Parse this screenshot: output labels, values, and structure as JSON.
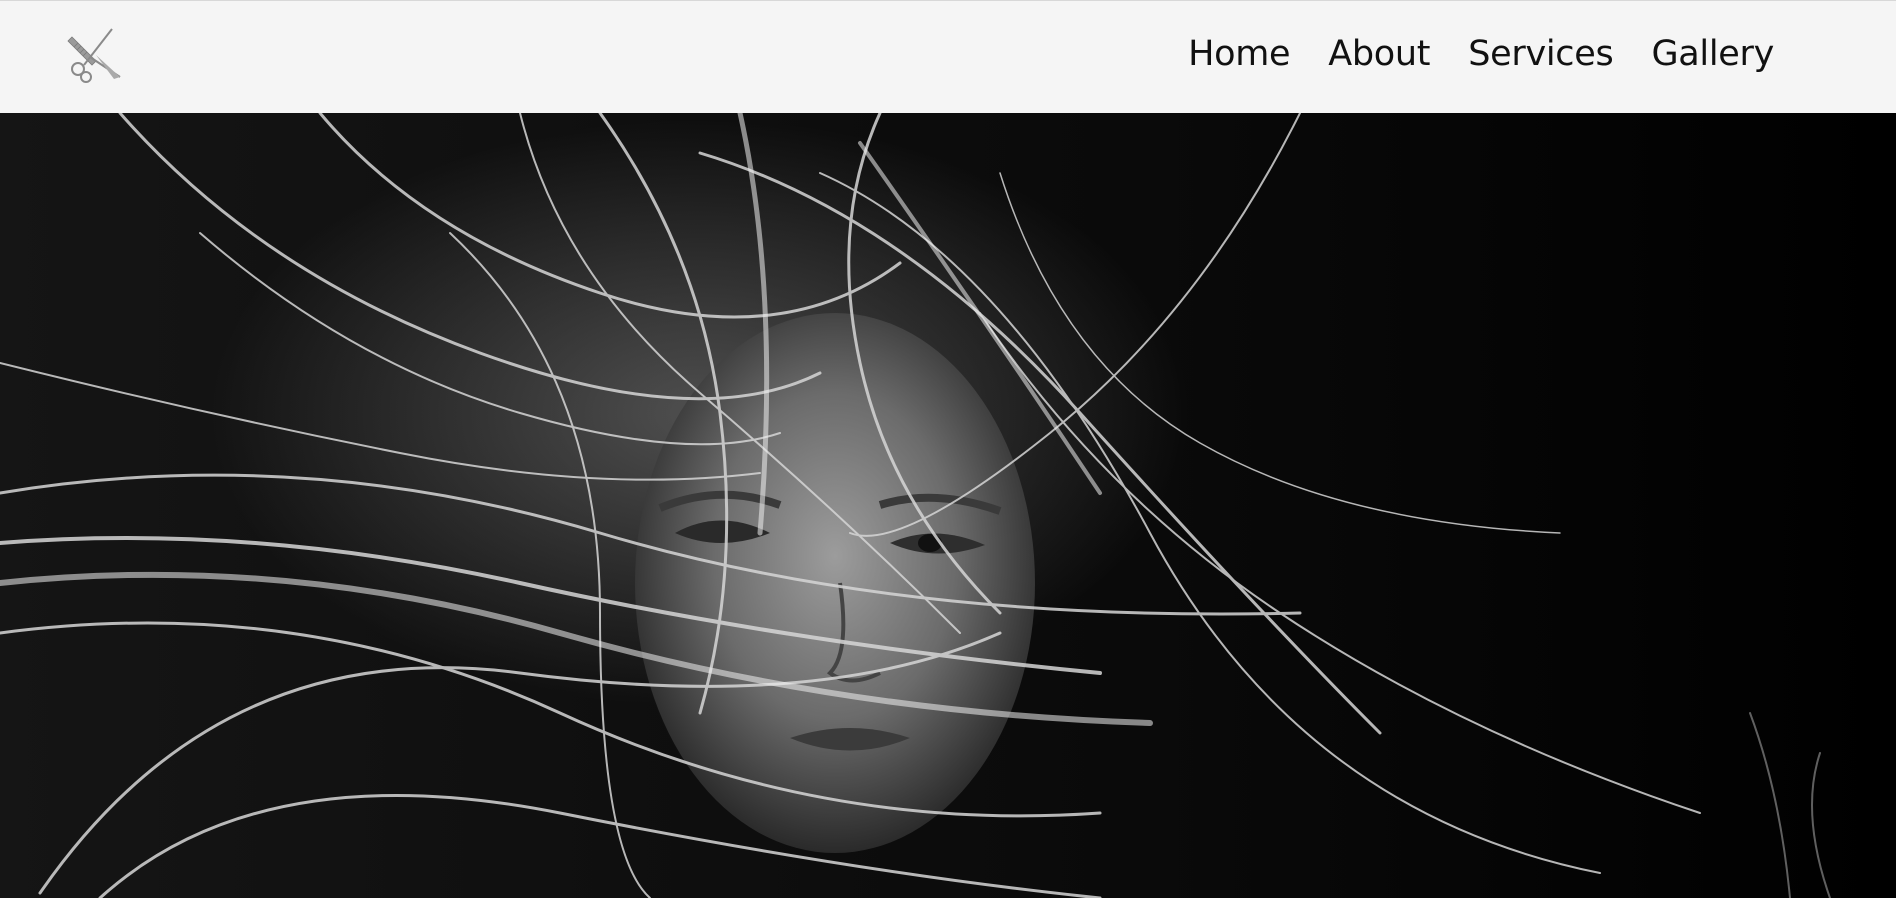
{
  "nav": {
    "logo_icon": "scissors-comb-icon",
    "links": [
      {
        "label": "Home"
      },
      {
        "label": "About"
      },
      {
        "label": "Services"
      },
      {
        "label": "Gallery"
      }
    ]
  },
  "hero": {
    "image": "black-and-white-portrait-woman-windblown-hair"
  },
  "colors": {
    "nav_bg": "#f5f5f5",
    "nav_text": "#111111",
    "hero_bg": "#000000"
  }
}
